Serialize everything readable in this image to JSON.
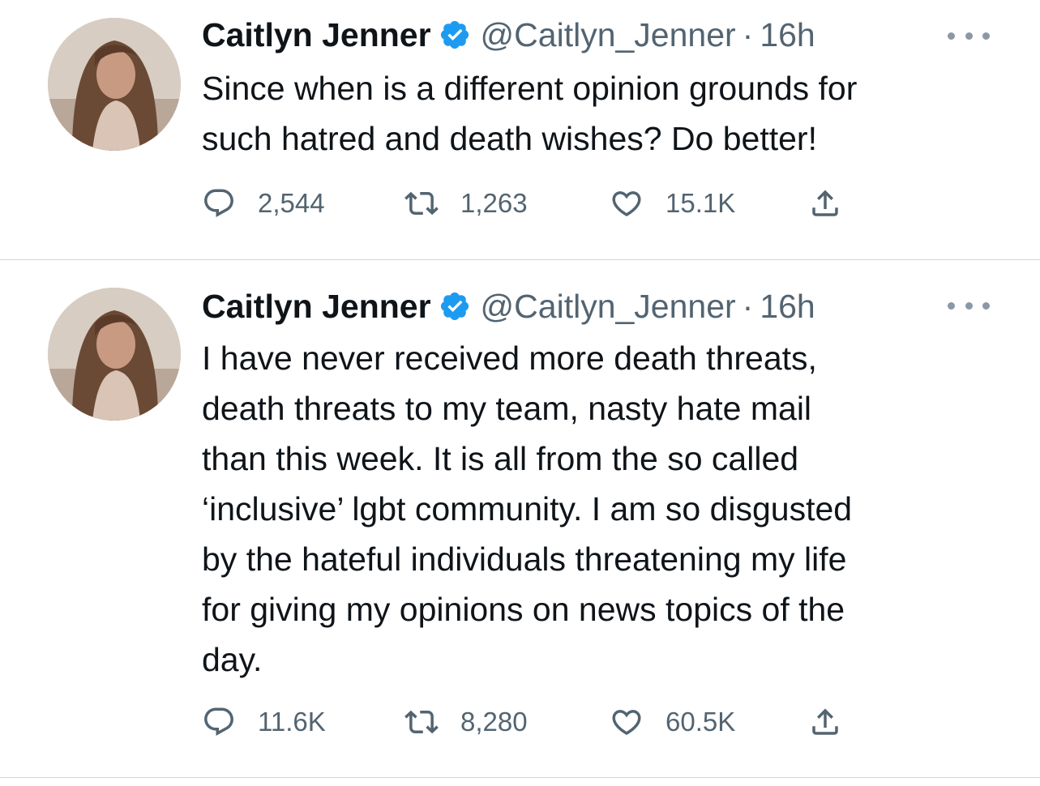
{
  "tweets": [
    {
      "author_name": "Caitlyn Jenner",
      "handle": "@Caitlyn_Jenner",
      "separator": "·",
      "time": "16h",
      "text": "Since when is a different opinion grounds for\nsuch hatred and death wishes? Do better!",
      "replies": "2,544",
      "retweets": "1,263",
      "likes": "15.1K",
      "icons": [
        "verified-badge-icon",
        "more-icon",
        "reply-icon",
        "retweet-icon",
        "like-icon",
        "share-icon"
      ]
    },
    {
      "author_name": "Caitlyn Jenner",
      "handle": "@Caitlyn_Jenner",
      "separator": "·",
      "time": "16h",
      "text": "I have never received more death threats,\ndeath threats to my team, nasty hate mail\nthan this week. It is all from the so called\n‘inclusive’ lgbt community. I am so disgusted\nby the hateful individuals threatening my life\nfor giving my opinions on news topics of the\nday.",
      "replies": "11.6K",
      "retweets": "8,280",
      "likes": "60.5K",
      "icons": [
        "verified-badge-icon",
        "more-icon",
        "reply-icon",
        "retweet-icon",
        "like-icon",
        "share-icon"
      ]
    }
  ],
  "colors": {
    "text_primary": "#0f1419",
    "text_secondary": "#536471",
    "verified_blue": "#1d9bf0",
    "divider": "#cfd9de"
  }
}
